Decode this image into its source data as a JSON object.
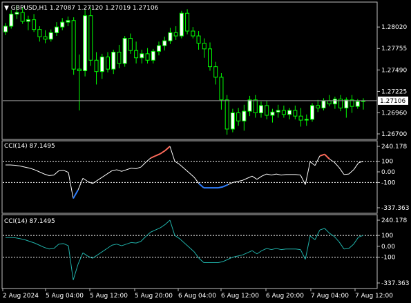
{
  "main_header": {
    "arrow": "▼",
    "text": "GBPUSD,H1  1.27087 1.27120 1.27019 1.27106"
  },
  "current_price_label": "1.27106",
  "indicator1_label": "CCI(14) 87.1495",
  "indicator2_label": "CCI(14) 87.1495",
  "colors": {
    "background": "#000000",
    "frame": "#c0c0c0",
    "candle": "#00ff00",
    "candle_body_up": "#ffffff",
    "cci_line": "#ffffff",
    "cci_over": "#ff6a5a",
    "cci_under": "#2f7fff",
    "cci2_line": "#20b2aa",
    "level_line": "#ffffff"
  },
  "chart_data": [
    {
      "type": "candlestick",
      "symbol": "GBPUSD",
      "timeframe": "H1",
      "yticks": [
        "1.28020",
        "1.27755",
        "1.27490",
        "1.27225",
        "1.26960",
        "1.26700"
      ],
      "ylim": [
        1.267,
        1.2826
      ],
      "xticks": [
        "2 Aug 2024",
        "5 Aug 04:00",
        "5 Aug 12:00",
        "5 Aug 20:00",
        "6 Aug 04:00",
        "6 Aug 12:00",
        "6 Aug 20:00",
        "7 Aug 04:00",
        "7 Aug 12:00"
      ],
      "candles": [
        [
          1.2796,
          1.2807,
          1.2792,
          1.2803
        ],
        [
          1.2803,
          1.2823,
          1.28,
          1.2818
        ],
        [
          1.2818,
          1.2829,
          1.2812,
          1.282
        ],
        [
          1.282,
          1.2826,
          1.2806,
          1.2809
        ],
        [
          1.2809,
          1.2816,
          1.2798,
          1.2811
        ],
        [
          1.2811,
          1.2818,
          1.2796,
          1.2799
        ],
        [
          1.2799,
          1.2803,
          1.2784,
          1.279
        ],
        [
          1.279,
          1.2798,
          1.2782,
          1.2787
        ],
        [
          1.2787,
          1.2799,
          1.2784,
          1.2795
        ],
        [
          1.2795,
          1.2808,
          1.2791,
          1.2802
        ],
        [
          1.2802,
          1.2813,
          1.2798,
          1.2808
        ],
        [
          1.2808,
          1.2815,
          1.2803,
          1.281
        ],
        [
          1.281,
          1.2814,
          1.2743,
          1.275
        ],
        [
          1.275,
          1.2768,
          1.2699,
          1.2748
        ],
        [
          1.2748,
          1.2823,
          1.2741,
          1.2816
        ],
        [
          1.2816,
          1.2826,
          1.2754,
          1.2761
        ],
        [
          1.2761,
          1.2771,
          1.2731,
          1.2747
        ],
        [
          1.2747,
          1.2769,
          1.2738,
          1.2765
        ],
        [
          1.2765,
          1.2771,
          1.2746,
          1.275
        ],
        [
          1.275,
          1.2774,
          1.2744,
          1.2771
        ],
        [
          1.2771,
          1.278,
          1.2751,
          1.2757
        ],
        [
          1.2757,
          1.2791,
          1.2753,
          1.2788
        ],
        [
          1.2788,
          1.2794,
          1.2769,
          1.2773
        ],
        [
          1.2773,
          1.2784,
          1.2757,
          1.2764
        ],
        [
          1.2764,
          1.2774,
          1.2757,
          1.2769
        ],
        [
          1.2769,
          1.2776,
          1.2757,
          1.2761
        ],
        [
          1.2761,
          1.2775,
          1.2757,
          1.2772
        ],
        [
          1.2772,
          1.2784,
          1.2767,
          1.2779
        ],
        [
          1.2779,
          1.279,
          1.2773,
          1.2785
        ],
        [
          1.2785,
          1.2801,
          1.2781,
          1.2795
        ],
        [
          1.2795,
          1.2803,
          1.2786,
          1.2791
        ],
        [
          1.2791,
          1.2822,
          1.2788,
          1.2819
        ],
        [
          1.2819,
          1.2824,
          1.2793,
          1.2797
        ],
        [
          1.2797,
          1.2802,
          1.2788,
          1.2791
        ],
        [
          1.2791,
          1.2797,
          1.2774,
          1.2782
        ],
        [
          1.2782,
          1.2788,
          1.2764,
          1.2775
        ],
        [
          1.2775,
          1.2783,
          1.2748,
          1.2753
        ],
        [
          1.2753,
          1.2759,
          1.2731,
          1.274
        ],
        [
          1.274,
          1.2745,
          1.27,
          1.2712
        ],
        [
          1.2712,
          1.2718,
          1.2669,
          1.2676
        ],
        [
          1.2676,
          1.2701,
          1.2672,
          1.2696
        ],
        [
          1.2696,
          1.2702,
          1.268,
          1.2686
        ],
        [
          1.2686,
          1.2706,
          1.2674,
          1.2698
        ],
        [
          1.2698,
          1.2717,
          1.2692,
          1.2712
        ],
        [
          1.2712,
          1.2718,
          1.269,
          1.2696
        ],
        [
          1.2696,
          1.271,
          1.269,
          1.2705
        ],
        [
          1.2705,
          1.2711,
          1.2688,
          1.2693
        ],
        [
          1.2693,
          1.2701,
          1.2684,
          1.2697
        ],
        [
          1.2697,
          1.2706,
          1.269,
          1.2699
        ],
        [
          1.2699,
          1.2705,
          1.269,
          1.2694
        ],
        [
          1.2694,
          1.2702,
          1.2688,
          1.2699
        ],
        [
          1.2699,
          1.2705,
          1.2688,
          1.2692
        ],
        [
          1.2692,
          1.2702,
          1.2679,
          1.2687
        ],
        [
          1.2687,
          1.2694,
          1.268,
          1.2688
        ],
        [
          1.2688,
          1.2708,
          1.2685,
          1.2705
        ],
        [
          1.2705,
          1.2712,
          1.2697,
          1.2702
        ],
        [
          1.2702,
          1.2714,
          1.2699,
          1.2711
        ],
        [
          1.2711,
          1.2718,
          1.2704,
          1.2707
        ],
        [
          1.2707,
          1.2716,
          1.2701,
          1.2713
        ],
        [
          1.2713,
          1.2718,
          1.2698,
          1.2702
        ],
        [
          1.2702,
          1.2715,
          1.269,
          1.2712
        ],
        [
          1.2712,
          1.2718,
          1.2696,
          1.2704
        ],
        [
          1.2704,
          1.2713,
          1.2701,
          1.271
        ],
        [
          1.271,
          1.2714,
          1.27,
          1.2711
        ]
      ]
    },
    {
      "type": "line",
      "name": "CCI(14) 87.1495",
      "yticks": [
        "240.178",
        "100",
        "0.00",
        "-100",
        "-337.363"
      ],
      "ylim": [
        -337.363,
        240.178
      ],
      "levels": [
        100,
        -100
      ],
      "values": [
        65,
        65,
        62,
        55,
        45,
        35,
        20,
        0,
        -20,
        -35,
        -30,
        10,
        15,
        -5,
        -250,
        -170,
        -60,
        -90,
        -110,
        -80,
        -50,
        -20,
        10,
        20,
        5,
        20,
        35,
        30,
        45,
        90,
        130,
        150,
        170,
        200,
        240,
        100,
        70,
        30,
        -10,
        -50,
        -110,
        -150,
        -150,
        -150,
        -150,
        -140,
        -120,
        -100,
        -90,
        -80,
        -60,
        -40,
        -70,
        -40,
        -20,
        -30,
        -20,
        -30,
        -25,
        -25,
        -25,
        -30,
        -120,
        95,
        60,
        150,
        165,
        120,
        90,
        40,
        -25,
        -20,
        20,
        85,
        100
      ]
    },
    {
      "type": "line",
      "name": "CCI(14) 87.1495",
      "yticks": [
        "240.178",
        "100",
        "0.00",
        "-100",
        "-337.363"
      ],
      "ylim": [
        -337.363,
        240.178
      ],
      "levels": [
        100,
        -100
      ],
      "values": [
        80,
        80,
        78,
        70,
        60,
        45,
        30,
        10,
        -10,
        -25,
        -20,
        20,
        25,
        5,
        -310,
        -165,
        -60,
        -90,
        -110,
        -80,
        -50,
        -20,
        10,
        20,
        5,
        20,
        35,
        30,
        45,
        90,
        130,
        150,
        170,
        200,
        240,
        100,
        70,
        30,
        -10,
        -50,
        -110,
        -150,
        -150,
        -150,
        -150,
        -140,
        -120,
        -100,
        -90,
        -80,
        -60,
        -40,
        -70,
        -40,
        -20,
        -30,
        -20,
        -30,
        -25,
        -25,
        -25,
        -30,
        -120,
        95,
        60,
        150,
        165,
        120,
        90,
        40,
        -25,
        -20,
        20,
        85,
        100
      ]
    }
  ]
}
